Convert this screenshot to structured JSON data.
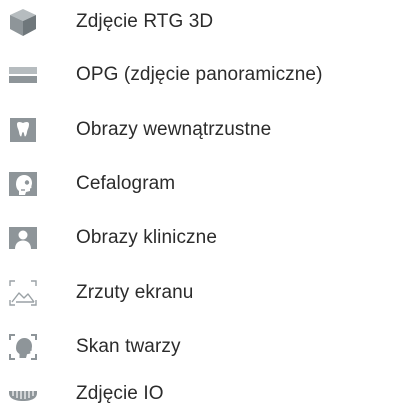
{
  "colors": {
    "text": "#2b2b2b",
    "icon": "#8e9599",
    "icon_light": "#b6bcbf",
    "icon_dark": "#6f777b",
    "background": "#ffffff"
  },
  "menu": {
    "items": [
      {
        "label": "Zdjęcie RTG 3D",
        "icon": "cube-icon"
      },
      {
        "label": "OPG (zdjęcie panoramiczne)",
        "icon": "panoramic-icon"
      },
      {
        "label": "Obrazy wewnątrzustne",
        "icon": "tooth-icon"
      },
      {
        "label": "Cefalogram",
        "icon": "skull-profile-icon"
      },
      {
        "label": "Obrazy kliniczne",
        "icon": "person-icon"
      },
      {
        "label": "Zrzuty ekranu",
        "icon": "screenshot-icon"
      },
      {
        "label": "Skan twarzy",
        "icon": "face-scan-icon"
      },
      {
        "label": "Zdjęcie IO",
        "icon": "teeth-arch-icon"
      }
    ]
  }
}
